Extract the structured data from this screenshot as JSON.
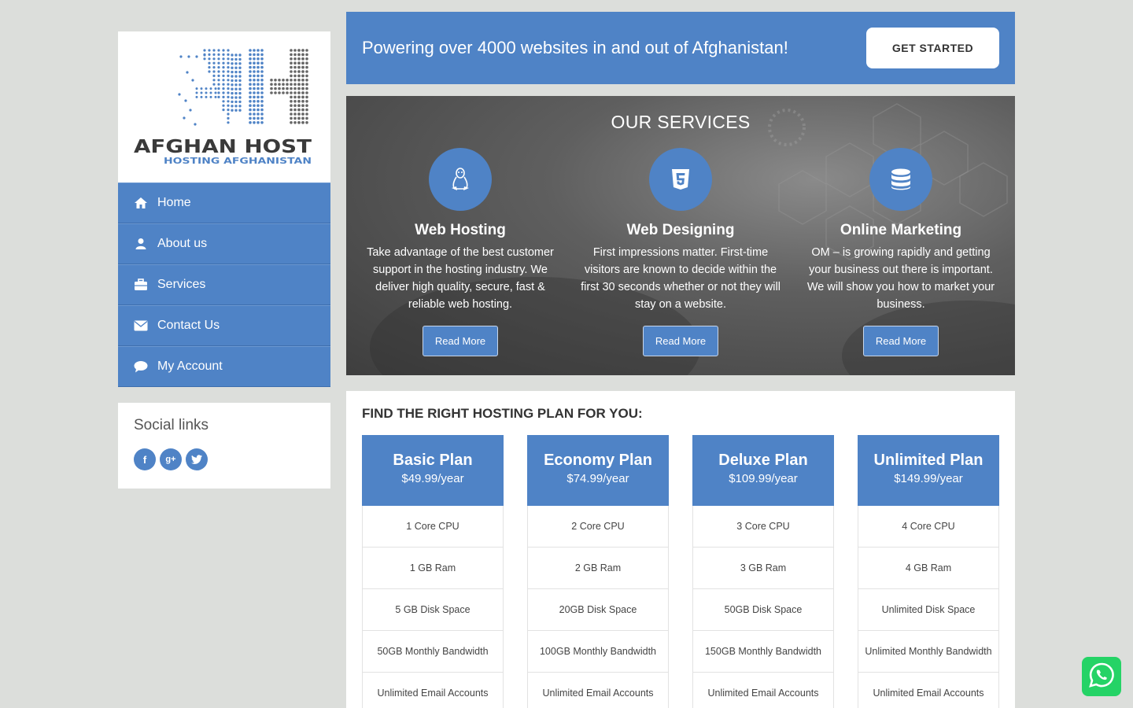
{
  "logo": {
    "brand": "AFGHAN HOST",
    "tagline": "HOSTING AFGHANISTAN"
  },
  "nav": [
    {
      "label": "Home",
      "icon": "home-icon"
    },
    {
      "label": "About us",
      "icon": "user-icon"
    },
    {
      "label": "Services",
      "icon": "briefcase-icon"
    },
    {
      "label": "Contact Us",
      "icon": "envelope-icon"
    },
    {
      "label": "My Account",
      "icon": "comment-icon"
    }
  ],
  "social": {
    "title": "Social links",
    "icons": [
      "facebook-icon",
      "google-plus-icon",
      "twitter-icon"
    ]
  },
  "banner": {
    "text": "Powering over 4000 websites in and out of Afghanistan!",
    "button": "GET STARTED"
  },
  "services": {
    "title": "OUR SERVICES",
    "items": [
      {
        "name": "Web Hosting",
        "icon": "linux-icon",
        "desc": "Take advantage of the best customer support in the hosting industry. We deliver high quality, secure, fast & reliable web hosting.",
        "button": "Read More"
      },
      {
        "name": "Web Designing",
        "icon": "html5-icon",
        "desc": "First impressions matter. First-time visitors are known to decide within the first 30 seconds whether or not they will stay on a website.",
        "button": "Read More"
      },
      {
        "name": "Online Marketing",
        "icon": "database-icon",
        "desc": "OM – is growing rapidly and getting your business out there is important. We will show you how to market your business.",
        "button": "Read More"
      }
    ]
  },
  "plans": {
    "title": "FIND THE RIGHT HOSTING PLAN FOR YOU:",
    "items": [
      {
        "name": "Basic Plan",
        "price": "$49.99/year",
        "features": [
          "1 Core CPU",
          "1 GB Ram",
          "5 GB Disk Space",
          "50GB Monthly Bandwidth",
          "Unlimited Email Accounts"
        ]
      },
      {
        "name": "Economy Plan",
        "price": "$74.99/year",
        "features": [
          "2 Core CPU",
          "2 GB Ram",
          "20GB Disk Space",
          "100GB Monthly Bandwidth",
          "Unlimited Email Accounts"
        ]
      },
      {
        "name": "Deluxe Plan",
        "price": "$109.99/year",
        "features": [
          "3 Core CPU",
          "3 GB Ram",
          "50GB Disk Space",
          "150GB Monthly Bandwidth",
          "Unlimited Email Accounts"
        ]
      },
      {
        "name": "Unlimited Plan",
        "price": "$149.99/year",
        "features": [
          "4 Core CPU",
          "4 GB Ram",
          "Unlimited Disk Space",
          "Unlimited Monthly Bandwidth",
          "Unlimited Email Accounts"
        ]
      }
    ]
  },
  "colors": {
    "accent": "#4f83c6",
    "page_bg": "#dcdedb",
    "whatsapp": "#25d366"
  }
}
